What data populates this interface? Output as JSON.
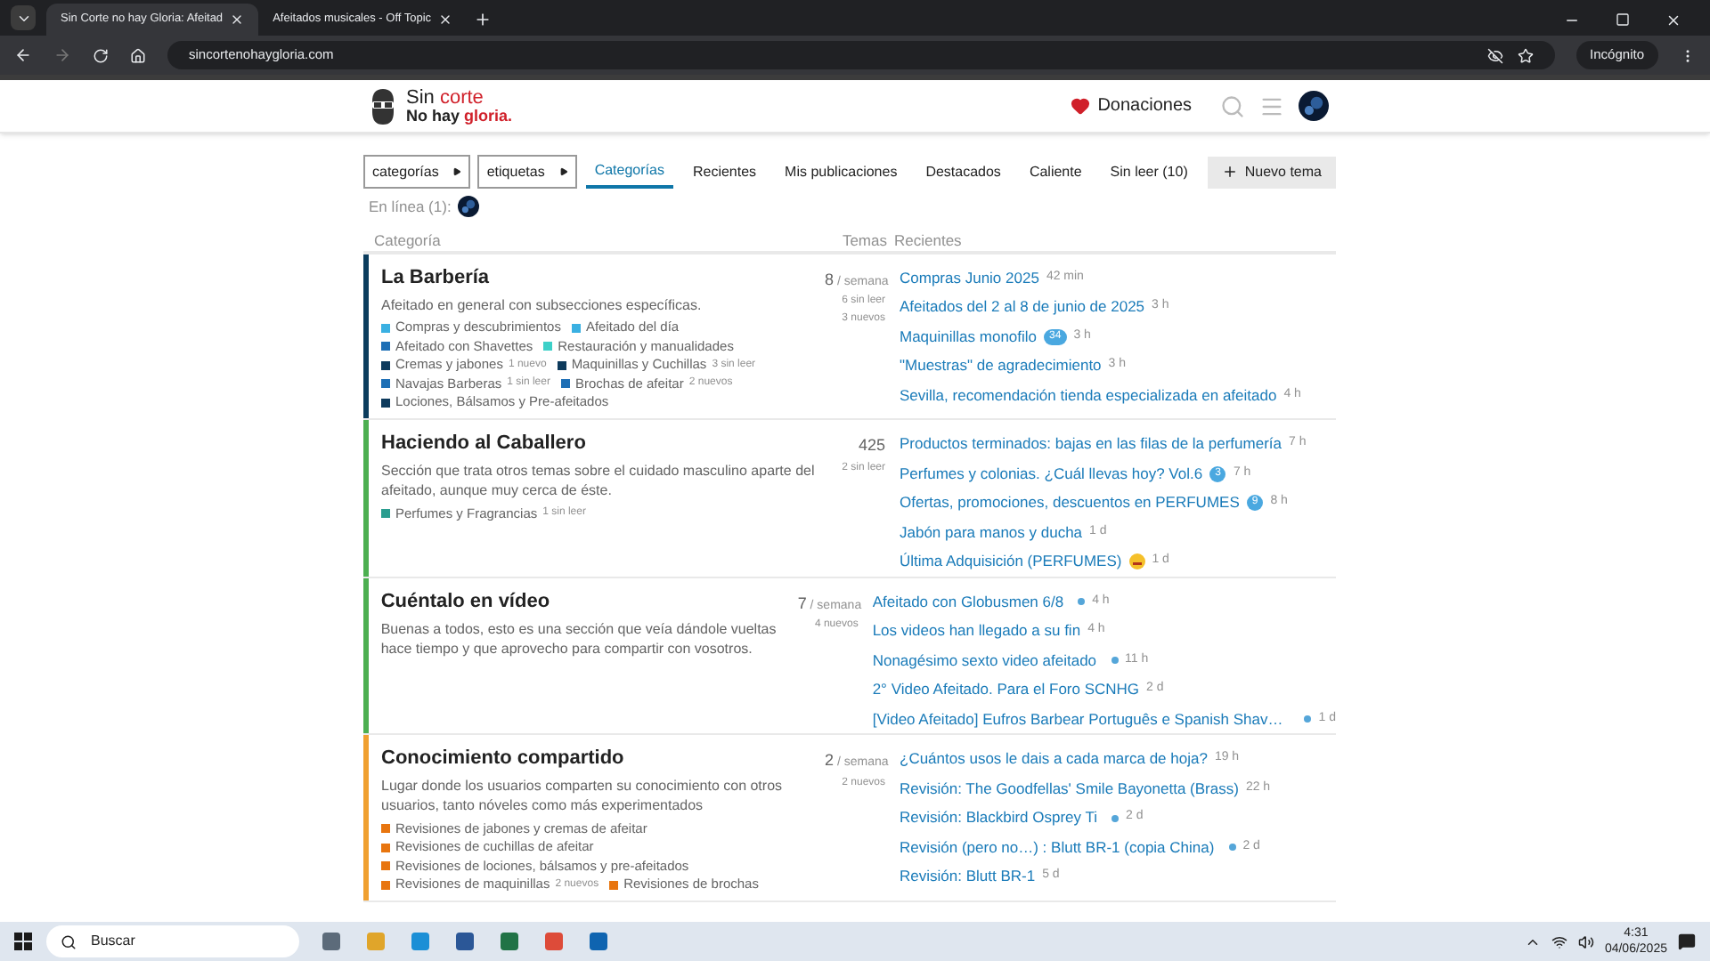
{
  "browser": {
    "tabs": [
      {
        "title": "Sin Corte no hay Gloria: Afeitad",
        "selected": true
      },
      {
        "title": "Afeitados musicales - Off Topic",
        "selected": false
      }
    ],
    "url": "sincortenohaygloria.com",
    "profile": "Incógnito"
  },
  "header": {
    "logo_line1": [
      "Sin",
      "corte"
    ],
    "logo_line2": [
      "No hay",
      "gloria."
    ],
    "donate": "Donaciones"
  },
  "nav": {
    "dropdowns": [
      "categorías",
      "etiquetas"
    ],
    "tabs": [
      {
        "label": "Categorías",
        "selected": true
      },
      {
        "label": "Recientes",
        "selected": false
      },
      {
        "label": "Mis publicaciones",
        "selected": false
      },
      {
        "label": "Destacados",
        "selected": false
      },
      {
        "label": "Caliente",
        "selected": false
      },
      {
        "label": "Sin leer (10)",
        "selected": false
      }
    ],
    "new_topic": "Nuevo tema"
  },
  "online": "En línea (1):",
  "columns": [
    "Categoría",
    "Temas",
    "Recientes"
  ],
  "categories": [
    {
      "name": "La Barbería",
      "color": "#0b3c5d",
      "description": "Afeitado en general con subsecciones específicas.",
      "count": "8",
      "count_unit": "/ semana",
      "stats": [
        "6 sin leer",
        "3 nuevos"
      ],
      "subcategories": [
        {
          "name": "Compras y descubrimientos",
          "color": "#3ab0e2"
        },
        {
          "name": "Afeitado del día",
          "color": "#3ab0e2"
        },
        {
          "name": "Afeitado con Shavettes",
          "color": "#1e6fb5"
        },
        {
          "name": "Restauración y manualidades",
          "color": "#3dd0c8"
        },
        {
          "name": "Cremas y jabones",
          "color": "#0d3a5c",
          "badge": "1 nuevo"
        },
        {
          "name": "Maquinillas y Cuchillas",
          "color": "#0d3a5c",
          "badge": "3 sin leer"
        },
        {
          "name": "Navajas Barberas",
          "color": "#1e6fb5",
          "badge": "1 sin leer"
        },
        {
          "name": "Brochas de afeitar",
          "color": "#1e6fb5",
          "badge": "2 nuevos"
        },
        {
          "name": "Lociones, Bálsamos y Pre-afeitados",
          "color": "#0d3a5c"
        }
      ],
      "topics": [
        {
          "title": "Compras Junio 2025",
          "age": "42 min"
        },
        {
          "title": "Afeitados del 2 al 8 de junio de 2025",
          "age": "3 h"
        },
        {
          "title": "Maquinillas monofilo",
          "unread": "34",
          "age": "3 h"
        },
        {
          "title": "\"Muestras\" de agradecimiento",
          "age": "3 h"
        },
        {
          "title": "Sevilla, recomendación tienda especializada en afeitado",
          "age": "4 h"
        }
      ]
    },
    {
      "name": "Haciendo al Caballero",
      "color": "#4caf50",
      "description": "Sección que trata otros temas sobre el cuidado masculino aparte del afeitado, aunque muy cerca de éste.",
      "count": "425",
      "stats": [
        "2 sin leer"
      ],
      "subcategories": [
        {
          "name": "Perfumes y Fragrancias",
          "color": "#2a9d8f",
          "badge": "1 sin leer"
        }
      ],
      "topics": [
        {
          "title": "Productos terminados: bajas en las filas de la perfumería",
          "age": "7 h"
        },
        {
          "title": "Perfumes y colonias. ¿Cuál llevas hoy? Vol.6",
          "unread": "3",
          "age": "7 h"
        },
        {
          "title": "Ofertas, promociones, descuentos en PERFUMES",
          "unread": "9",
          "age": "8 h"
        },
        {
          "title": "Jabón para manos y ducha",
          "age": "1 d"
        },
        {
          "title": "Última Adquisición (PERFUMES)",
          "emoji": true,
          "age": "1 d"
        }
      ]
    },
    {
      "name": "Cuéntalo en vídeo",
      "color": "#4caf50",
      "description": "Buenas a todos, esto es una sección que veía dándole vueltas hace tiempo y que aprovecho para compartir con vosotros.",
      "count": "7",
      "count_unit": "/ semana",
      "stats": [
        "4 nuevos"
      ],
      "topics": [
        {
          "title": "Afeitado con Globusmen 6/8",
          "new_dot": true,
          "age": "4 h"
        },
        {
          "title": "Los videos han llegado a su fin",
          "age": "4 h"
        },
        {
          "title": "Nonagésimo sexto video afeitado",
          "new_dot": true,
          "age": "11 h"
        },
        {
          "title": "2° Video Afeitado. Para el Foro SCNHG",
          "age": "2 d"
        },
        {
          "title": "[Video Afeitado] Eufros Barbear Português e Spanish Shav…",
          "new_dot": true,
          "age": "1 d"
        }
      ]
    },
    {
      "name": "Conocimiento compartido",
      "color": "#f0a030",
      "description": "Lugar donde los usuarios comparten su conocimiento con otros usuarios, tanto nóveles como más experimentados",
      "count": "2",
      "count_unit": "/ semana",
      "stats": [
        "2 nuevos"
      ],
      "subcategories": [
        {
          "name": "Revisiones de jabones y cremas de afeitar",
          "color": "#e8750f"
        },
        {
          "name": "Revisiones de cuchillas de afeitar",
          "color": "#e8750f"
        },
        {
          "name": "Revisiones de lociones, bálsamos y pre-afeitados",
          "color": "#e8750f"
        },
        {
          "name": "Revisiones de maquinillas",
          "color": "#e8750f",
          "badge": "2 nuevos"
        },
        {
          "name": "Revisiones de brochas",
          "color": "#e8750f"
        }
      ],
      "topics": [
        {
          "title": "¿Cuántos usos le dais a cada marca de hoja?",
          "age": "19 h"
        },
        {
          "title": "Revisión: The Goodfellas' Smile Bayonetta (Brass)",
          "age": "22 h"
        },
        {
          "title": "Revisión: Blackbird Osprey Ti",
          "new_dot": true,
          "age": "2 d"
        },
        {
          "title": "Revisión (pero no…) : Blutt BR-1 (copia China)",
          "new_dot": true,
          "age": "2 d"
        },
        {
          "title": "Revisión: Blutt BR-1",
          "age": "5 d"
        }
      ]
    }
  ],
  "taskbar": {
    "search": "Buscar",
    "time": "4:31",
    "date": "04/06/2025"
  }
}
